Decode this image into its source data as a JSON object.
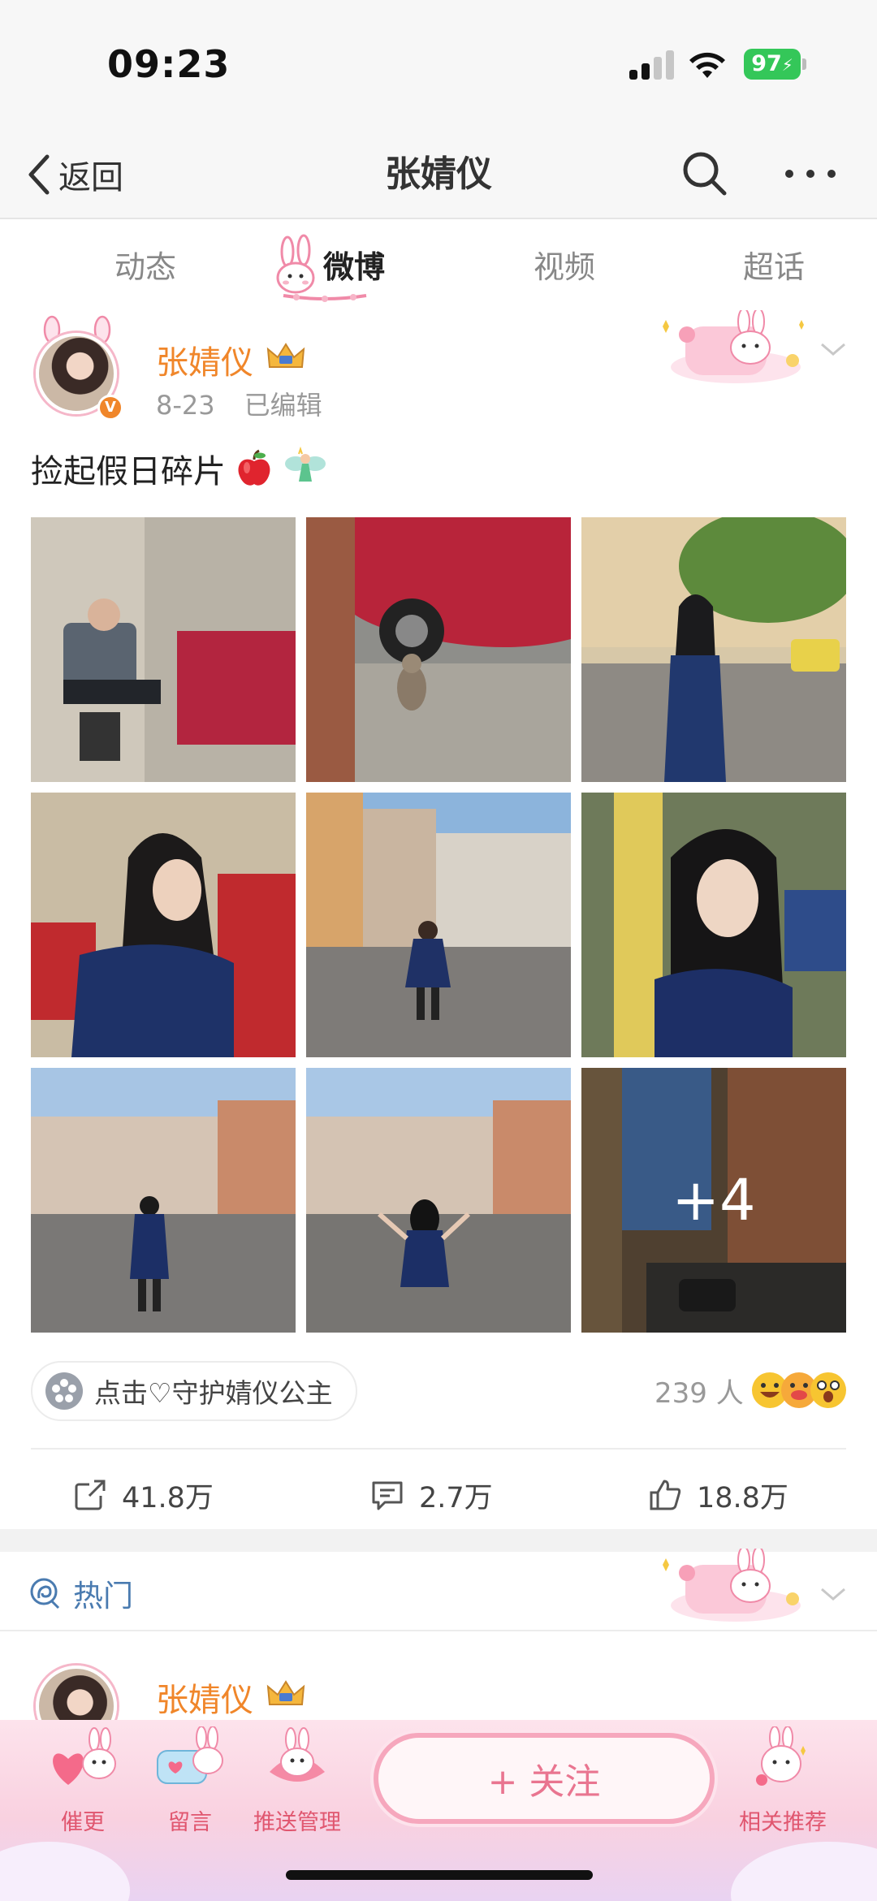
{
  "status_bar": {
    "time": "09:23",
    "battery": "97"
  },
  "nav": {
    "back_label": "返回",
    "title": "张婧仪"
  },
  "tabs": [
    {
      "label": "动态"
    },
    {
      "label": "微博"
    },
    {
      "label": "视频"
    },
    {
      "label": "超话"
    }
  ],
  "post": {
    "author": "张婧仪",
    "date": "8-23",
    "edited": "已编辑",
    "text": "捡起假日碎片",
    "photos_more": "+4",
    "guard_label": "点击♡守护婧仪公主",
    "guard_count": "239 人",
    "actions": {
      "repost": "41.8万",
      "comment": "2.7万",
      "like": "18.8万"
    }
  },
  "hot_section": {
    "label": "热门",
    "author": "张婧仪"
  },
  "bottom_bar": {
    "items": [
      {
        "label": "催更"
      },
      {
        "label": "留言"
      },
      {
        "label": "推送管理"
      },
      {
        "label": "相关推荐"
      }
    ],
    "follow_label": "+ 关注"
  },
  "colors": {
    "accent": "#f0862a",
    "link": "#4a7bb0",
    "pink": "#e97590"
  }
}
